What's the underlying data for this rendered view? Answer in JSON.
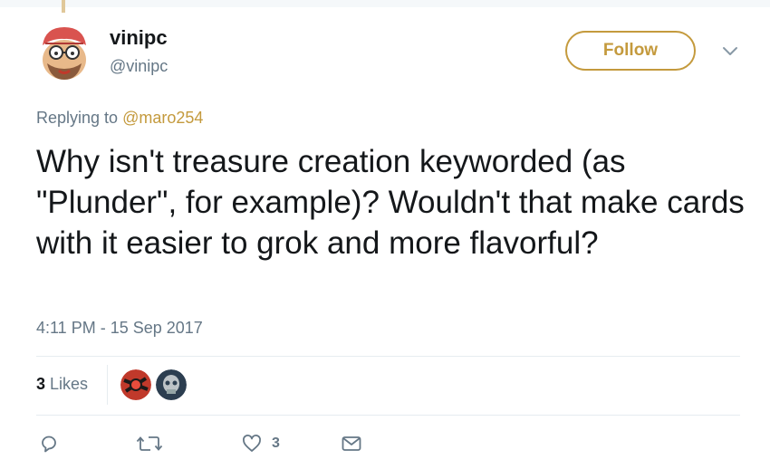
{
  "user": {
    "display_name": "vinipc",
    "handle": "@vinipc"
  },
  "follow_label": "Follow",
  "reply": {
    "prefix": "Replying to ",
    "target": "@maro254"
  },
  "tweet": {
    "text": "Why isn't treasure creation keyworded (as \"Plunder\", for example)? Wouldn't that make cards with it easier to grok and more flavorful?",
    "timestamp": "4:11 PM - 15 Sep 2017"
  },
  "stats": {
    "likes_count": "3",
    "likes_label": " Likes"
  },
  "actions": {
    "like_count": "3"
  },
  "icons": [
    "chevron-down-icon",
    "reply-icon",
    "retweet-icon",
    "heart-icon",
    "message-icon"
  ],
  "colors": {
    "accent": "#c49a3d",
    "secondary_text": "#657786"
  }
}
